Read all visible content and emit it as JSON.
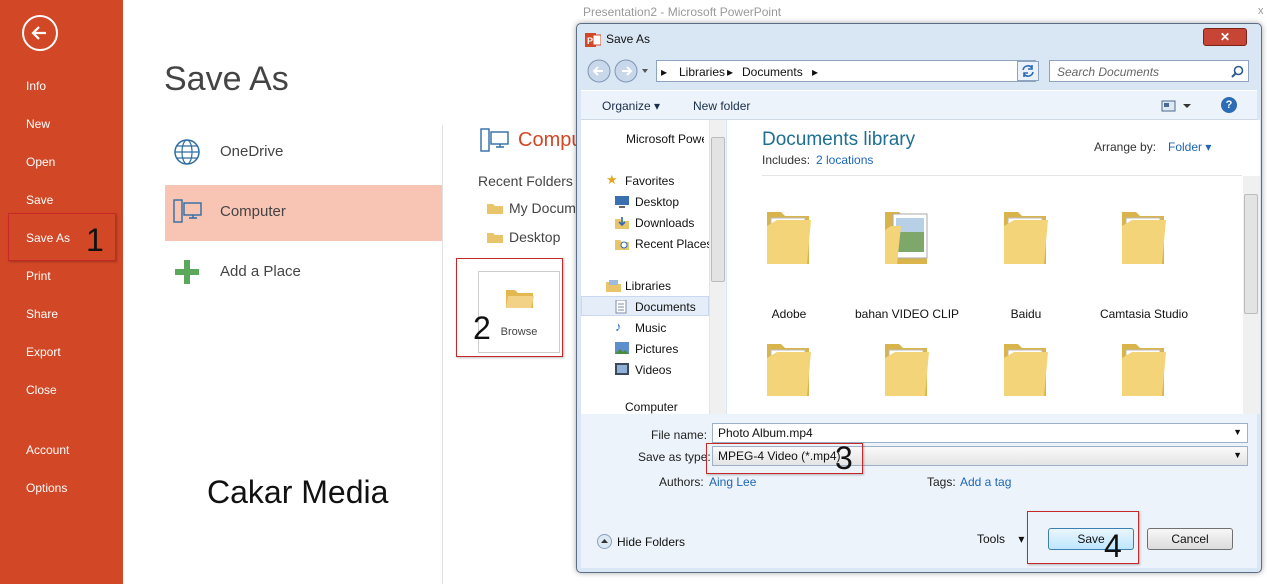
{
  "window": {
    "title": "Presentation2 - Microsoft PowerPoint",
    "close": "x"
  },
  "backstage": {
    "title": "Save As",
    "menu": [
      "Info",
      "New",
      "Open",
      "Save",
      "Save As",
      "Print",
      "Share",
      "Export",
      "Close",
      "Account",
      "Options"
    ],
    "places": [
      "OneDrive",
      "Computer",
      "Add a Place"
    ],
    "computer_header": "Computer",
    "recent_header": "Recent Folders",
    "recent": [
      "My Documents",
      "Desktop"
    ],
    "browse": "Browse"
  },
  "watermark": "Cakar Media",
  "steps": [
    "1",
    "2",
    "3",
    "4"
  ],
  "dialog": {
    "title": "Save As",
    "breadcrumb": [
      "Libraries",
      "Documents"
    ],
    "search_placeholder": "Search Documents",
    "toolbar": {
      "organize": "Organize",
      "new_folder": "New folder",
      "help": "?"
    },
    "nav": {
      "app": "Microsoft PowerPoint",
      "favorites": "Favorites",
      "favorite_items": [
        "Desktop",
        "Downloads",
        "Recent Places"
      ],
      "libraries": "Libraries",
      "library_items": [
        "Documents",
        "Music",
        "Pictures",
        "Videos"
      ],
      "computer": "Computer"
    },
    "content": {
      "title": "Documents library",
      "includes_label": "Includes:",
      "includes_link": "2 locations",
      "arrange_label": "Arrange by:",
      "arrange_value": "Folder",
      "folders": [
        "Adobe",
        "bahan VIDEO CLIP",
        "Baidu",
        "Camtasia Studio",
        "",
        "",
        "",
        ""
      ]
    },
    "fields": {
      "file_name_label": "File name:",
      "file_name": "Photo Album.mp4",
      "type_label": "Save as type:",
      "type_value": "MPEG-4 Video (*.mp4)",
      "authors_label": "Authors:",
      "authors": "Aing Lee",
      "tags_label": "Tags:",
      "tags": "Add a tag"
    },
    "bottom": {
      "hide_folders": "Hide Folders",
      "tools": "Tools",
      "save": "Save",
      "cancel": "Cancel"
    }
  },
  "colors": {
    "accent": "#D24726",
    "selected_place": "#F8C5B4",
    "link": "#1E66B6",
    "library_title": "#1E6F92"
  }
}
